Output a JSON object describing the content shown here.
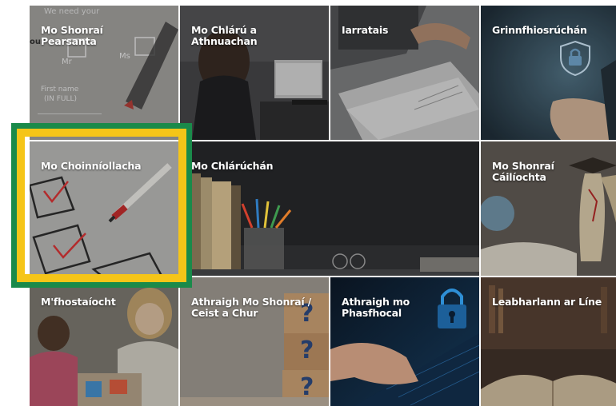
{
  "tiles": {
    "personal": {
      "label": "Mo Shonraí\nPearsanta"
    },
    "renew": {
      "label": "Mo Chlárú a\nAthnuachan"
    },
    "requests": {
      "label": "Iarratais"
    },
    "security": {
      "label": "Grinnfhiosrúchán"
    },
    "conditions": {
      "label": "Mo Choinníollacha"
    },
    "registrations": {
      "label": "Mo Chlárúchán"
    },
    "qualifications": {
      "label": "Mo Shonraí\nCáilíochta"
    },
    "employment": {
      "label": "M'fhostaíocht"
    },
    "change_details": {
      "label": "Athraigh Mo Shonraí /\nCeist a Chur"
    },
    "change_password": {
      "label": "Athraigh mo\nPhasfhocal"
    },
    "library": {
      "label": "Leabharlann ar Líne"
    }
  },
  "form_snippet": {
    "line1": "We need your",
    "line2": "our",
    "mr": "Mr",
    "ms": "Ms",
    "first_name": "First name",
    "in_full": "(IN FULL)"
  },
  "highlight": {
    "outer_color": "#1a8a4a",
    "inner_color": "#f5c518",
    "selected": "conditions"
  },
  "icons": [
    "padlock-icon",
    "question-mark-icon",
    "checkbox-icon"
  ]
}
